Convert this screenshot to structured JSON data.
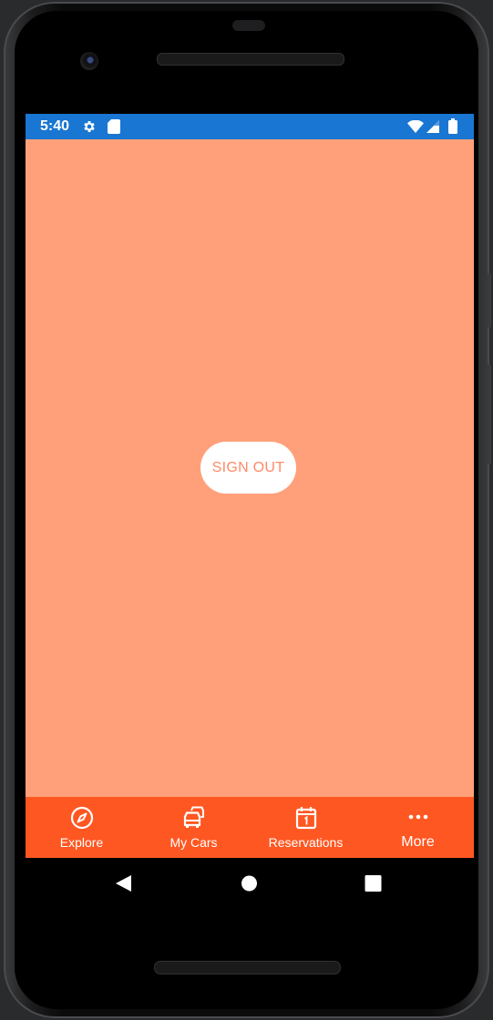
{
  "status_bar": {
    "time": "5:40",
    "color": "#1976d2",
    "icons": [
      "gear-icon",
      "sd-card-icon",
      "wifi-icon",
      "signal-icon",
      "battery-icon"
    ]
  },
  "main": {
    "background": "#ffa07a",
    "sign_out_label": "SIGN OUT"
  },
  "tab_bar": {
    "color": "#ff5722",
    "tabs": [
      {
        "label": "Explore",
        "icon": "compass-icon"
      },
      {
        "label": "My Cars",
        "icon": "cars-icon"
      },
      {
        "label": "Reservations",
        "icon": "calendar-icon"
      },
      {
        "label": "More",
        "icon": "more-icon"
      }
    ]
  },
  "nav_bar": {
    "buttons": [
      "back-icon",
      "home-icon",
      "recents-icon"
    ]
  }
}
